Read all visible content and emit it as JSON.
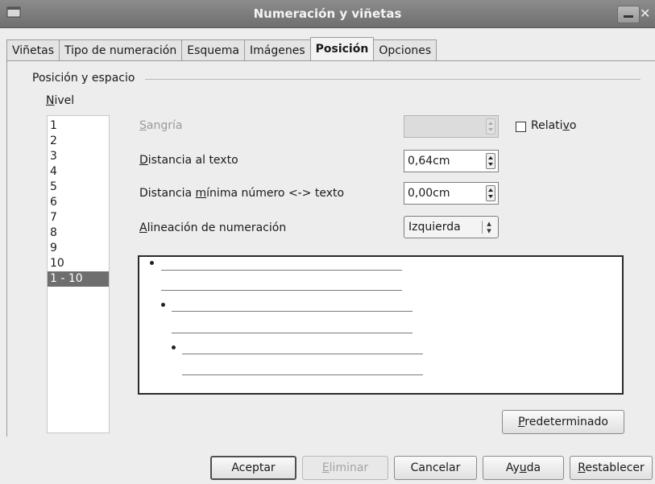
{
  "window": {
    "title": "Numeración y viñetas",
    "close_glyph": "✕"
  },
  "tabs": [
    {
      "label": "Viñetas"
    },
    {
      "label": "Tipo de numeración"
    },
    {
      "label": "Esquema"
    },
    {
      "label": "Imágenes"
    },
    {
      "label": "Posición",
      "active": true
    },
    {
      "label": "Opciones"
    }
  ],
  "section": {
    "title": "Posición y espacio",
    "level_label_mnemonic": "N",
    "level_label_rest": "ivel"
  },
  "levels": [
    "1",
    "2",
    "3",
    "4",
    "5",
    "6",
    "7",
    "8",
    "9",
    "10",
    "1 - 10"
  ],
  "selected_level": "1 - 10",
  "form": {
    "sangria": {
      "label_mnemonic": "S",
      "label_rest": "angría",
      "value": "",
      "enabled": false
    },
    "relativo": {
      "label_pre": "Relati",
      "label_mnemonic": "v",
      "label_post": "o",
      "checked": false
    },
    "distancia": {
      "label_mnemonic": "D",
      "label_rest": "istancia al texto",
      "value": "0,64cm"
    },
    "distancia_minima": {
      "label_pre": "Distancia ",
      "label_mnemonic": "m",
      "label_post": "ínima número <-> texto",
      "value": "0,00cm"
    },
    "alineacion": {
      "label_mnemonic": "A",
      "label_rest": "lineación de numeración",
      "value": "Izquierda",
      "icon": "updown-icon"
    }
  },
  "buttons": {
    "predeterminado": {
      "mnemonic": "P",
      "rest": "redeterminado"
    },
    "aceptar": "Aceptar",
    "eliminar": {
      "mnemonic": "E",
      "rest": "liminar",
      "enabled": false
    },
    "cancelar": "Cancelar",
    "ayuda": {
      "pre": "Ay",
      "mnemonic": "u",
      "post": "da"
    },
    "restablecer": {
      "mnemonic": "R",
      "rest": "establecer"
    }
  },
  "colors": {
    "titlebar": "#7a7a7a",
    "selection": "#6e6e6e",
    "panel": "#ededed"
  }
}
